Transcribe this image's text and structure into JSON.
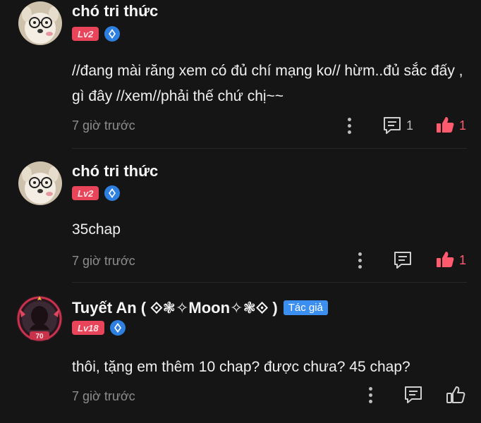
{
  "comments": [
    {
      "username": "chó tri thức",
      "level": "Lv2",
      "content": "//đang mài răng xem có đủ chí mạng ko// hừm..đủ sắc đấy , gì đây //xem//phải thế chứ chị~~",
      "time": "7 giờ trước",
      "reply_count": "1",
      "like_count": "1",
      "liked": true,
      "avatar_icon": "dog-with-glasses-avatar"
    },
    {
      "username": "chó tri thức",
      "level": "Lv2",
      "content": "35chap",
      "time": "7 giờ trước",
      "reply_count": "",
      "like_count": "1",
      "liked": true,
      "avatar_icon": "dog-with-glasses-avatar"
    },
    {
      "username": "Tuyết An ( ⟐❃✧Moon✧❃⟐ )",
      "author_tag": "Tác giả",
      "level": "Lv18",
      "avatar_badge": "70",
      "content": "thôi, tặng em thêm 10 chap? được chưa? 45 chap?",
      "time": "7 giờ trước",
      "reply_count": "",
      "like_count": "",
      "liked": false,
      "avatar_icon": "anime-girl-frame-avatar"
    }
  ],
  "colors": {
    "background": "#151515",
    "like_active": "#ff5a6e",
    "level_badge": "#e8445a",
    "author_tag": "#3b8ff0",
    "muted_text": "#8d8d8d"
  }
}
